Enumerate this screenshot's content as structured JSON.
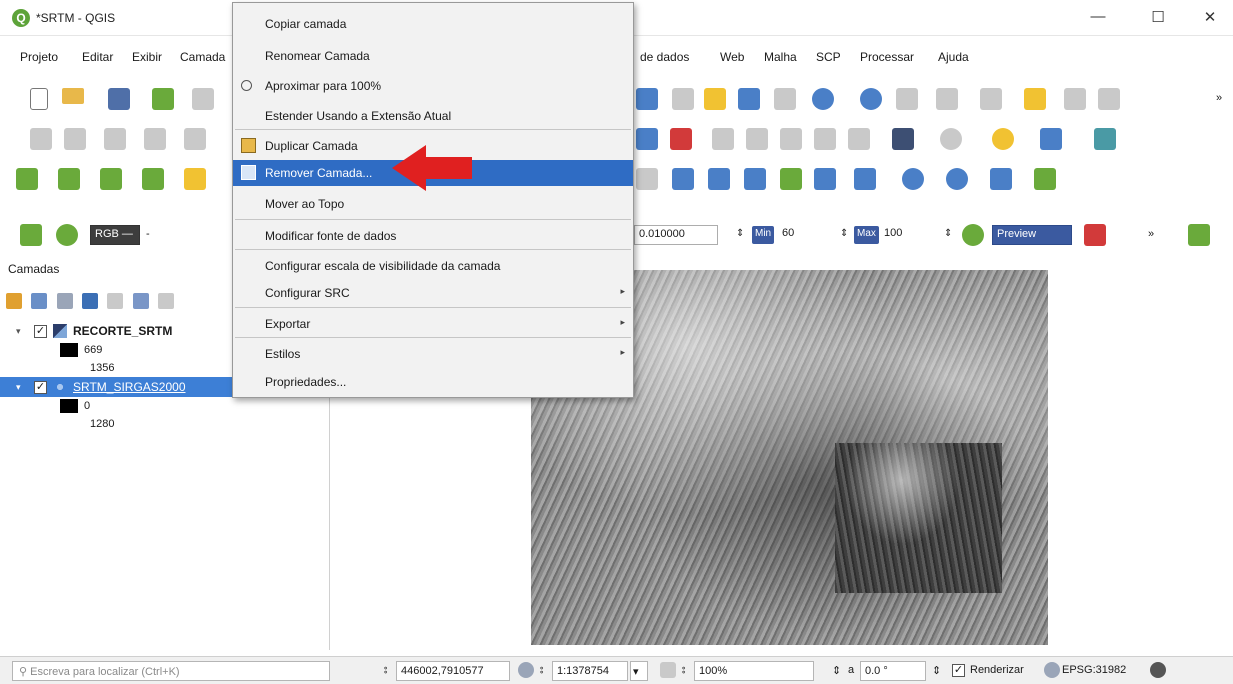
{
  "window": {
    "title": "*SRTM - QGIS",
    "minimize": "—",
    "maximize": "☐",
    "close": "✕"
  },
  "menubar": [
    "Projeto",
    "Editar",
    "Exibir",
    "Camada",
    "de dados",
    "Web",
    "Malha",
    "SCP",
    "Processar",
    "Ajuda"
  ],
  "toolbar": {
    "rgb_label": "RGB —",
    "dash": "-",
    "threshold_value": "0.010000",
    "min_label": "Min",
    "min_value": "60",
    "max_label": "Max",
    "max_value": "100",
    "preview_label": "Preview",
    "more": "»"
  },
  "layers_panel": {
    "title": "Camadas",
    "layers": [
      {
        "name": "RECORTE_SRTM",
        "checked": "✓",
        "min": "669",
        "max": "1356"
      },
      {
        "name": "SRTM_SIRGAS2000",
        "checked": "✓",
        "min": "0",
        "max": "1280"
      }
    ]
  },
  "context_menu": {
    "items": [
      {
        "label": "Copiar camada"
      },
      {
        "label": "Renomear Camada"
      },
      {
        "label": "Aproximar para 100%"
      },
      {
        "label": "Estender Usando a Extensão Atual"
      },
      {
        "label": "Duplicar Camada"
      },
      {
        "label": "Remover Camada..."
      },
      {
        "label": "Mover ao Topo"
      },
      {
        "label": "Modificar fonte de dados"
      },
      {
        "label": "Configurar escala de visibilidade da camada"
      },
      {
        "label": "Configurar SRC",
        "submenu": "▸"
      },
      {
        "label": "Exportar",
        "submenu": "▸"
      },
      {
        "label": "Estilos",
        "submenu": "▸"
      },
      {
        "label": "Propriedades..."
      }
    ],
    "highlight_color": "#2f6cc4"
  },
  "statusbar": {
    "search_placeholder": "Escreva para localizar (Ctrl+K)",
    "coordinate": "446002,7910577",
    "scale": "1:1378754",
    "magnifier": "100%",
    "rotation": "0.0 °",
    "render_label": "Renderizar",
    "crs": "EPSG:31982",
    "coord_prefix": "⦂",
    "scale_prefix": "⦂",
    "mag_prefix": "⦂",
    "rot_prefix": "a"
  },
  "colors": {
    "selection": "#3d7fd6",
    "arrow": "#e02020"
  }
}
